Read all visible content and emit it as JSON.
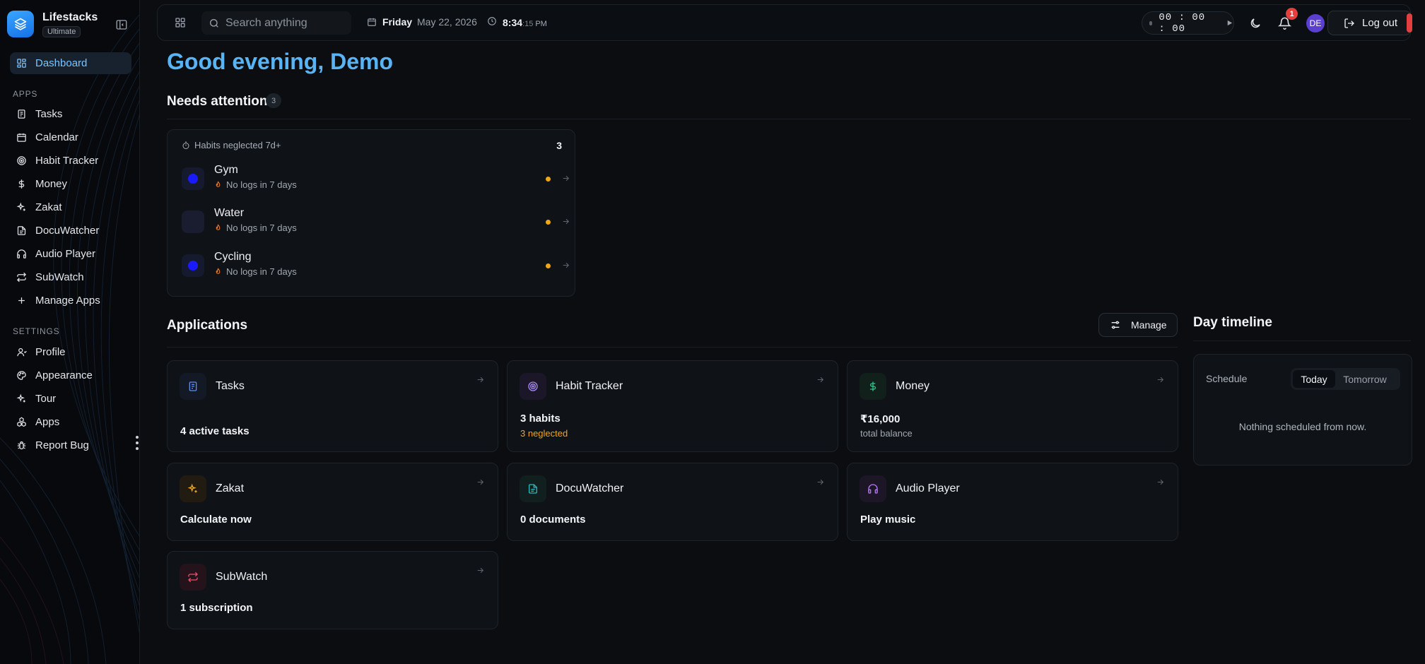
{
  "brand": {
    "name": "Lifestacks",
    "plan": "Ultimate"
  },
  "sidebar": {
    "dashboard": {
      "label": "Dashboard",
      "active": true
    },
    "apps_heading": "APPS",
    "apps": [
      {
        "label": "Tasks",
        "icon": "tasks-icon"
      },
      {
        "label": "Calendar",
        "icon": "calendar-icon"
      },
      {
        "label": "Habit Tracker",
        "icon": "target-icon"
      },
      {
        "label": "Money",
        "icon": "dollar-icon"
      },
      {
        "label": "Zakat",
        "icon": "sparkle-icon"
      },
      {
        "label": "DocuWatcher",
        "icon": "document-icon"
      },
      {
        "label": "Audio Player",
        "icon": "headphones-icon"
      },
      {
        "label": "SubWatch",
        "icon": "repeat-icon"
      },
      {
        "label": "Manage Apps",
        "icon": "plus-icon"
      }
    ],
    "settings_heading": "SETTINGS",
    "settings": [
      {
        "label": "Profile",
        "icon": "user-icon"
      },
      {
        "label": "Appearance",
        "icon": "palette-icon"
      },
      {
        "label": "Tour",
        "icon": "sparkle-icon"
      },
      {
        "label": "Apps",
        "icon": "apps-icon"
      },
      {
        "label": "Report Bug",
        "icon": "bug-icon"
      }
    ]
  },
  "topbar": {
    "search_placeholder": "Search anything",
    "day": "Friday",
    "date": "May 22, 2026",
    "time_hm": "8:34",
    "time_sec": ":15",
    "time_ampm": "PM",
    "timer": "00 : 00 : 00",
    "notifications_count": "1",
    "avatar_initials": "DE",
    "logout_label": "Log out"
  },
  "greeting": "Good evening, Demo",
  "needs_attention": {
    "title": "Needs attention",
    "count": "3",
    "card": {
      "heading": "Habits neglected 7d+",
      "count": "3",
      "habits": [
        {
          "name": "Gym",
          "status": "No logs in 7 days",
          "color": "#1a1aff"
        },
        {
          "name": "Water",
          "status": "No logs in 7 days",
          "color": "#2a2a52"
        },
        {
          "name": "Cycling",
          "status": "No logs in 7 days",
          "color": "#1a1aff"
        }
      ]
    }
  },
  "applications": {
    "title": "Applications",
    "manage_label": "Manage",
    "cards": [
      {
        "title": "Tasks",
        "primary": "4 active tasks",
        "secondary": ""
      },
      {
        "title": "Habit Tracker",
        "primary": "3 habits",
        "secondary": "3 neglected"
      },
      {
        "title": "Money",
        "primary": "₹16,000",
        "secondary": "total balance"
      },
      {
        "title": "Zakat",
        "primary": "Calculate now",
        "secondary": ""
      },
      {
        "title": "DocuWatcher",
        "primary": "0 documents",
        "secondary": ""
      },
      {
        "title": "Audio Player",
        "primary": "Play music",
        "secondary": ""
      },
      {
        "title": "SubWatch",
        "primary": "1 subscription",
        "secondary": ""
      }
    ]
  },
  "timeline": {
    "title": "Day timeline",
    "schedule_label": "Schedule",
    "tab_today": "Today",
    "tab_tomorrow": "Tomorrow",
    "empty_text": "Nothing scheduled from now."
  },
  "colors": {
    "accent": "#58b4f5",
    "warning": "#f2a51a",
    "danger": "#e53e3e",
    "background": "#0b0d10"
  }
}
